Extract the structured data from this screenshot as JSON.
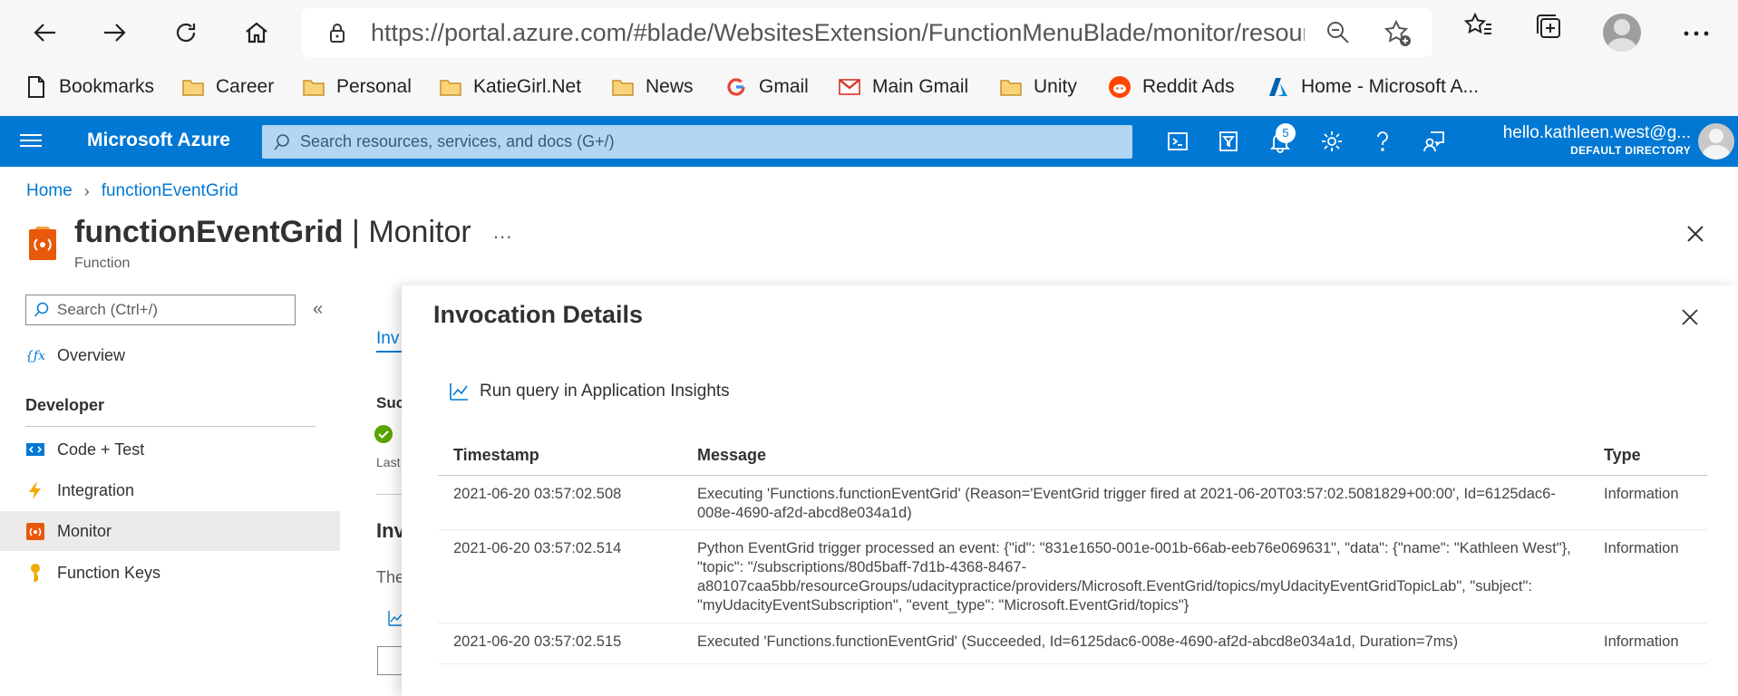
{
  "browser": {
    "url": "https://portal.azure.com/#blade/WebsitesExtension/FunctionMenuBlade/monitor/resourceId...",
    "bookmarks": [
      "Bookmarks",
      "Career",
      "Personal",
      "KatieGirl.Net",
      "News",
      "Gmail",
      "Main Gmail",
      "Unity",
      "Reddit Ads",
      "Home - Microsoft A..."
    ]
  },
  "azure": {
    "brand": "Microsoft Azure",
    "search_placeholder": "Search resources, services, and docs (G+/)",
    "notifications_count": "5",
    "account_email": "hello.kathleen.west@g...",
    "account_directory": "DEFAULT DIRECTORY",
    "accent": "#0078d4"
  },
  "breadcrumb": [
    "Home",
    "functionEventGrid"
  ],
  "header": {
    "resource_name": "functionEventGrid",
    "separator": "|",
    "blade": "Monitor",
    "subtitle": "Function",
    "more": "..."
  },
  "sidebar": {
    "search_placeholder": "Search (Ctrl+/)",
    "collapse": "«",
    "overview": "Overview",
    "section": "Developer",
    "items": [
      "Code + Test",
      "Integration",
      "Monitor",
      "Function Keys"
    ]
  },
  "background_peek": {
    "tab": "Inv",
    "label_success": "Suc",
    "label_last": "Last",
    "section": "Inv",
    "text": "The"
  },
  "panel": {
    "title": "Invocation Details",
    "run_query": "Run query in Application Insights",
    "columns": [
      "Timestamp",
      "Message",
      "Type"
    ],
    "rows": [
      {
        "timestamp": "2021-06-20 03:57:02.508",
        "message": "Executing 'Functions.functionEventGrid' (Reason='EventGrid trigger fired at 2021-06-20T03:57:02.5081829+00:00', Id=6125dac6-008e-4690-af2d-abcd8e034a1d)",
        "type": "Information"
      },
      {
        "timestamp": "2021-06-20 03:57:02.514",
        "message": "Python EventGrid trigger processed an event: {\"id\": \"831e1650-001e-001b-66ab-eeb76e069631\", \"data\": {\"name\": \"Kathleen West\"}, \"topic\": \"/subscriptions/80d5baff-7d1b-4368-8467-a80107caa5bb/resourceGroups/udacitypractice/providers/Microsoft.EventGrid/topics/myUdacityEventGridTopicLab\", \"subject\": \"myUdacityEventSubscription\", \"event_type\": \"Microsoft.EventGrid/topics\"}",
        "type": "Information"
      },
      {
        "timestamp": "2021-06-20 03:57:02.515",
        "message": "Executed 'Functions.functionEventGrid' (Succeeded, Id=6125dac6-008e-4690-af2d-abcd8e034a1d, Duration=7ms)",
        "type": "Information"
      }
    ]
  }
}
